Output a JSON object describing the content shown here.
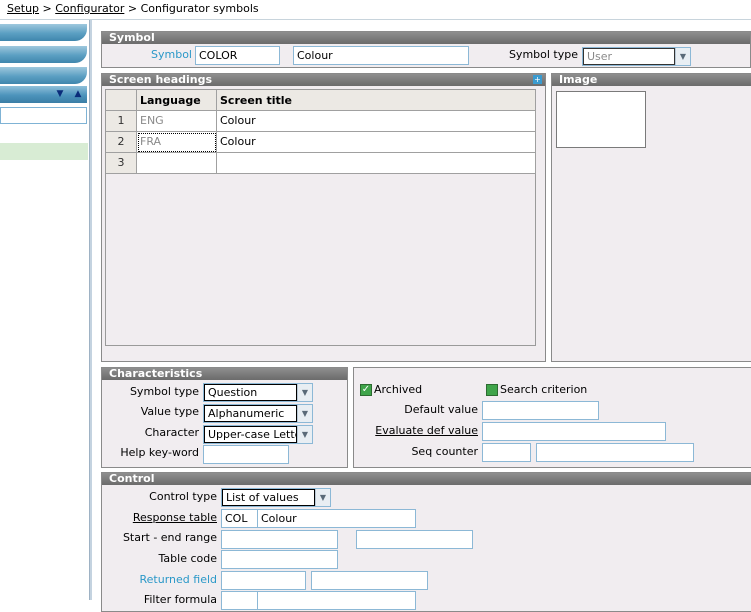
{
  "breadcrumb": {
    "items": [
      "Setup",
      "Configurator",
      "Configurator symbols"
    ],
    "separator": ">"
  },
  "symbol": {
    "title": "Symbol",
    "symbol_label": "Symbol",
    "symbol_code": "COLOR",
    "symbol_description": "Colour",
    "symbol_type_label": "Symbol type",
    "symbol_type_value": "User"
  },
  "screen_headings": {
    "title": "Screen headings",
    "columns": [
      "Language",
      "Screen title"
    ],
    "rows": [
      {
        "num": "1",
        "language": "ENG",
        "title": "Colour"
      },
      {
        "num": "2",
        "language": "FRA",
        "title": "Colour"
      },
      {
        "num": "3",
        "language": "",
        "title": ""
      }
    ]
  },
  "image": {
    "title": "Image"
  },
  "characteristics": {
    "title": "Characteristics",
    "symbol_type_label": "Symbol type",
    "symbol_type_value": "Question",
    "value_type_label": "Value type",
    "value_type_value": "Alphanumeric",
    "character_label": "Character",
    "character_value": "Upper-case Letter",
    "help_label": "Help key-word",
    "help_value": ""
  },
  "options": {
    "archived_label": "Archived",
    "archived_checked": true,
    "search_label": "Search criterion",
    "default_value_label": "Default value",
    "evaluate_label": "Evaluate def value",
    "seq_counter_label": "Seq counter"
  },
  "control": {
    "title": "Control",
    "control_type_label": "Control type",
    "control_type_value": "List of values",
    "response_table_label": "Response table",
    "response_table_code": "COL",
    "response_table_desc": "Colour",
    "start_end_label": "Start - end range",
    "table_code_label": "Table code",
    "returned_field_label": "Returned field",
    "filter_formula_label": "Filter formula"
  },
  "colors": {
    "accent": "#2a98c8",
    "header": "#7a7a7a",
    "panel": "#f1edf0"
  }
}
